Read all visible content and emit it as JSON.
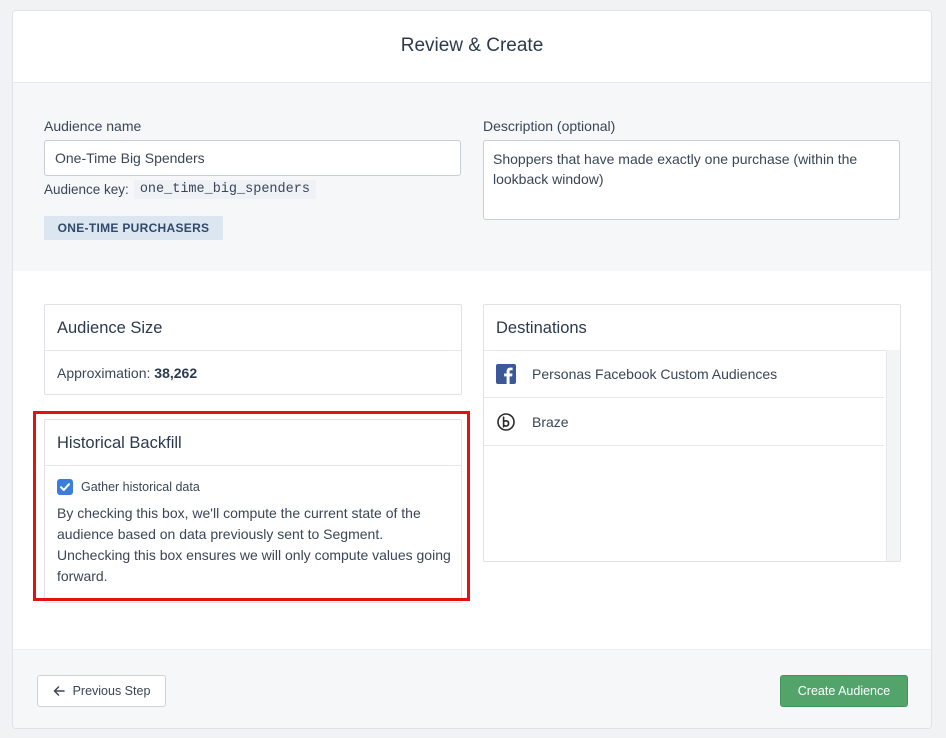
{
  "header": {
    "title": "Review & Create"
  },
  "audience": {
    "name_label": "Audience name",
    "name_value": "One-Time Big Spenders",
    "key_label": "Audience key:",
    "key_value": "one_time_big_spenders",
    "tag": "ONE-TIME PURCHASERS"
  },
  "description": {
    "label": "Description (optional)",
    "value": "Shoppers that have made exactly one purchase (within the lookback window)"
  },
  "size_card": {
    "title": "Audience Size",
    "approx_label": "Approximation:",
    "approx_value": "38,262"
  },
  "backfill_card": {
    "title": "Historical Backfill",
    "checkbox_label": "Gather historical data",
    "checkbox_checked": true,
    "description": "By checking this box, we'll compute the current state of the audience based on data previously sent to Segment. Unchecking this box ensures we will only compute values going forward."
  },
  "destinations_card": {
    "title": "Destinations",
    "items": [
      {
        "label": "Personas Facebook Custom Audiences",
        "icon": "facebook-icon"
      },
      {
        "label": "Braze",
        "icon": "braze-icon"
      }
    ]
  },
  "footer": {
    "prev_label": "Previous Step",
    "create_label": "Create Audience"
  },
  "colors": {
    "primary_green": "#52a46b",
    "checkbox_blue": "#3b7ddd",
    "highlight_red": "#e41111",
    "facebook_blue": "#3b5998"
  }
}
